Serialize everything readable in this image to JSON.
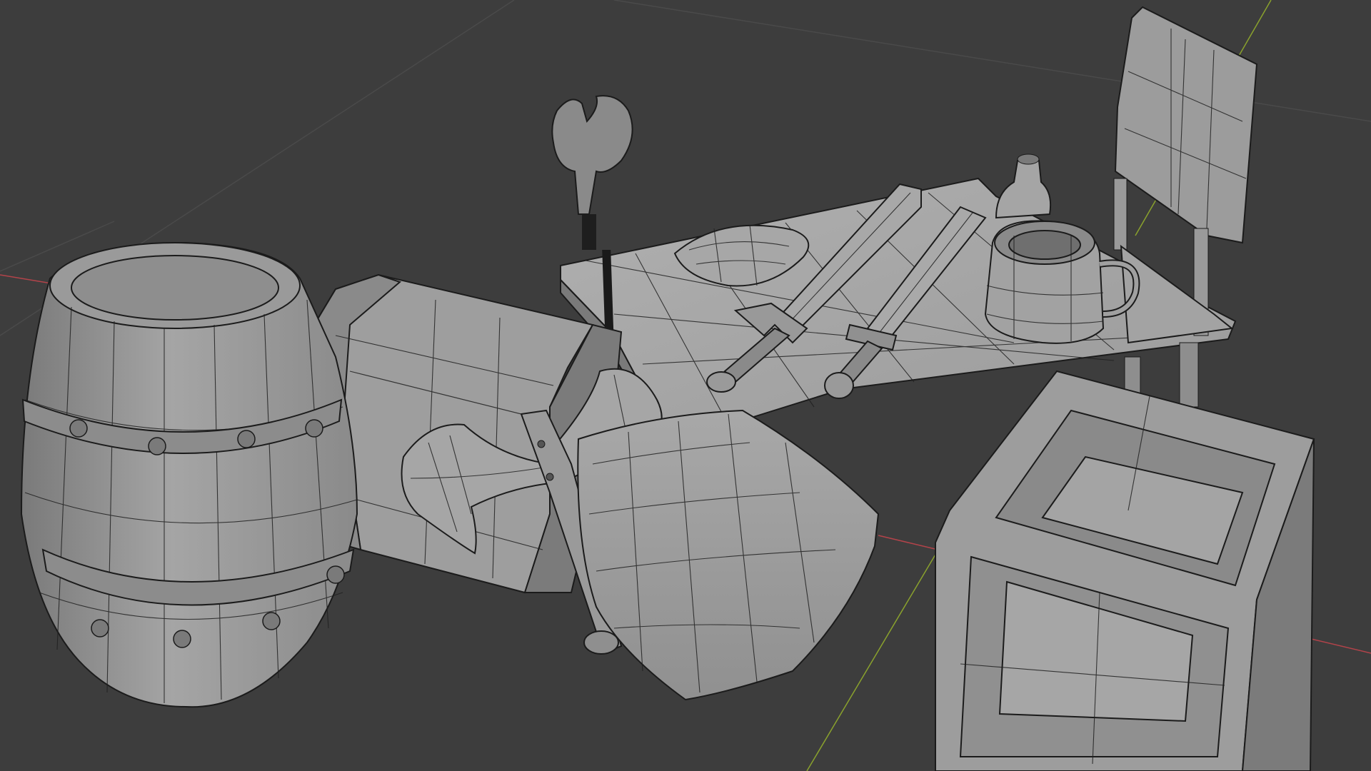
{
  "viewport": {
    "background": "#3d3d3d",
    "grid_line_color": "#4a4a4a",
    "x_axis_color": "#b3434a",
    "y_axis_color": "#8aa22d",
    "mesh_fill_light": "#a9a9a9",
    "mesh_fill_mid": "#8e8e8e",
    "mesh_fill_dark": "#6c6c6c",
    "wire_color": "#202020"
  },
  "objects": [
    {
      "name": "barrel",
      "icon": "barrel-mesh"
    },
    {
      "name": "treasure-chest",
      "icon": "chest-mesh"
    },
    {
      "name": "magic-staff",
      "icon": "staff-mesh"
    },
    {
      "name": "battle-axe",
      "icon": "axe-mesh"
    },
    {
      "name": "shield",
      "icon": "shield-mesh"
    },
    {
      "name": "table",
      "icon": "table-mesh"
    },
    {
      "name": "ornate-sword",
      "icon": "sword-mesh"
    },
    {
      "name": "short-sword",
      "icon": "sword-mesh"
    },
    {
      "name": "bowl",
      "icon": "bowl-mesh"
    },
    {
      "name": "bottle",
      "icon": "bottle-mesh"
    },
    {
      "name": "tankard",
      "icon": "tankard-mesh"
    },
    {
      "name": "chair",
      "icon": "chair-mesh"
    },
    {
      "name": "crate",
      "icon": "crate-mesh"
    }
  ]
}
